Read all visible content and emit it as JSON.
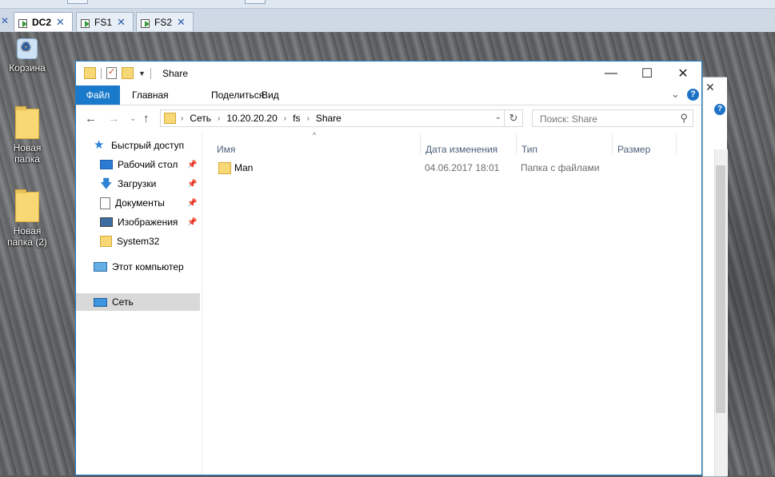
{
  "vm_tabs": [
    {
      "label": "DC2",
      "active": true
    },
    {
      "label": "FS1",
      "active": false
    },
    {
      "label": "FS2",
      "active": false
    }
  ],
  "desktop_icons": [
    {
      "label": "Корзина",
      "icon": "recycle-bin-icon"
    },
    {
      "label": "Новая папка",
      "icon": "folder-icon"
    },
    {
      "label": "Новая папка (2)",
      "icon": "folder-icon"
    }
  ],
  "window": {
    "title": "Share",
    "controls": {
      "minimize": "—",
      "maximize": "☐",
      "close": "✕"
    }
  },
  "ribbon": {
    "tabs": [
      "Файл",
      "Главная",
      "Поделиться",
      "Вид"
    ],
    "active_tab": "Файл",
    "accent_color": "#1979ca"
  },
  "address": {
    "crumbs": [
      "Сеть",
      "10.20.20.20",
      "fs",
      "Share"
    ]
  },
  "search": {
    "placeholder": "Поиск: Share"
  },
  "nav_pane": {
    "quick_access": "Быстрый доступ",
    "pinned": [
      "Рабочий стол",
      "Загрузки",
      "Документы",
      "Изображения"
    ],
    "unpinned": [
      "System32"
    ],
    "this_pc": "Этот компьютер",
    "network": "Сеть",
    "selected": "Сеть"
  },
  "file_list": {
    "columns": [
      "Имя",
      "Дата изменения",
      "Тип",
      "Размер"
    ],
    "rows": [
      {
        "name": "Man",
        "date": "04.06.2017 18:01",
        "type": "Папка с файлами",
        "size": ""
      }
    ]
  }
}
